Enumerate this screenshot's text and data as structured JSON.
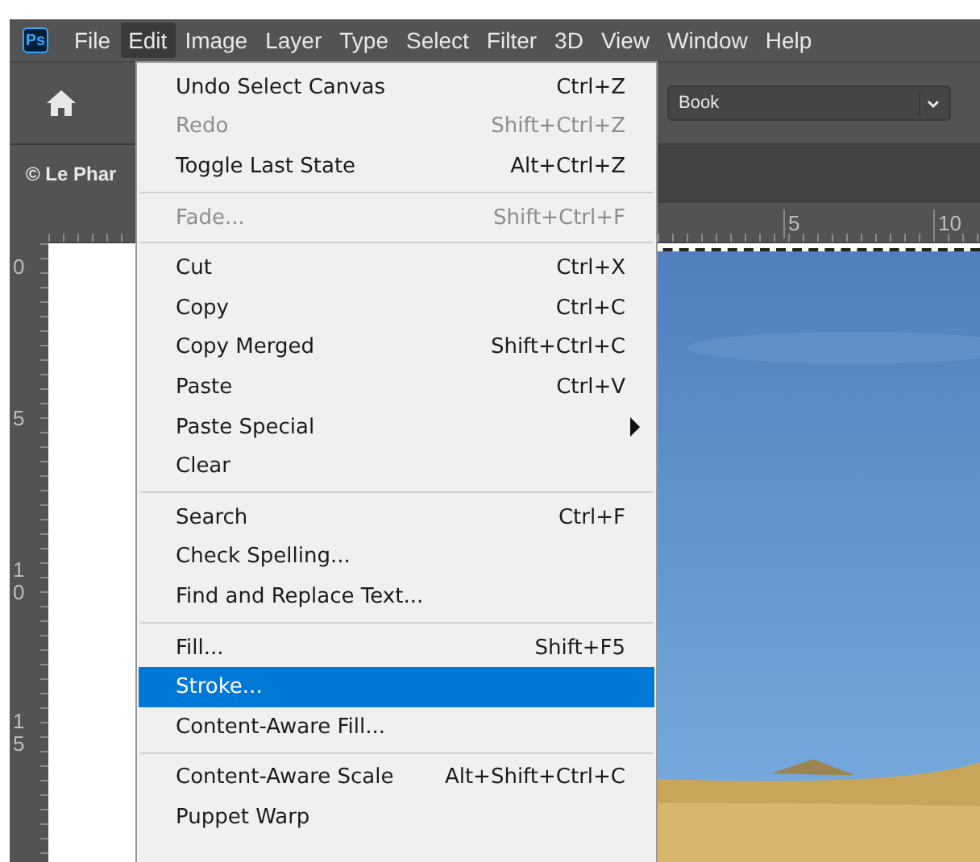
{
  "app": {
    "logo": "Ps"
  },
  "menubar": [
    {
      "label": "File",
      "selected": false
    },
    {
      "label": "Edit",
      "selected": true
    },
    {
      "label": "Image",
      "selected": false
    },
    {
      "label": "Layer",
      "selected": false
    },
    {
      "label": "Type",
      "selected": false
    },
    {
      "label": "Select",
      "selected": false
    },
    {
      "label": "Filter",
      "selected": false
    },
    {
      "label": "3D",
      "selected": false
    },
    {
      "label": "View",
      "selected": false
    },
    {
      "label": "Window",
      "selected": false
    },
    {
      "label": "Help",
      "selected": false
    }
  ],
  "options_bar": {
    "dropdown_value": "Book"
  },
  "document_tab": {
    "title": "© Le Phar"
  },
  "ruler": {
    "horizontal": [
      "5",
      "10"
    ],
    "vertical": [
      "0",
      "5",
      "10",
      "15"
    ]
  },
  "edit_menu": {
    "groups": [
      [
        {
          "label": "Undo Select Canvas",
          "shortcut": "Ctrl+Z",
          "disabled": false,
          "selected": false
        },
        {
          "label": "Redo",
          "shortcut": "Shift+Ctrl+Z",
          "disabled": true,
          "selected": false
        },
        {
          "label": "Toggle Last State",
          "shortcut": "Alt+Ctrl+Z",
          "disabled": false,
          "selected": false
        }
      ],
      [
        {
          "label": "Fade...",
          "shortcut": "Shift+Ctrl+F",
          "disabled": true,
          "selected": false
        }
      ],
      [
        {
          "label": "Cut",
          "shortcut": "Ctrl+X",
          "disabled": false,
          "selected": false
        },
        {
          "label": "Copy",
          "shortcut": "Ctrl+C",
          "disabled": false,
          "selected": false
        },
        {
          "label": "Copy Merged",
          "shortcut": "Shift+Ctrl+C",
          "disabled": false,
          "selected": false
        },
        {
          "label": "Paste",
          "shortcut": "Ctrl+V",
          "disabled": false,
          "selected": false
        },
        {
          "label": "Paste Special",
          "submenu": true,
          "disabled": false,
          "selected": false
        },
        {
          "label": "Clear",
          "disabled": false,
          "selected": false
        }
      ],
      [
        {
          "label": "Search",
          "shortcut": "Ctrl+F",
          "disabled": false,
          "selected": false
        },
        {
          "label": "Check Spelling...",
          "disabled": false,
          "selected": false
        },
        {
          "label": "Find and Replace Text...",
          "disabled": false,
          "selected": false
        }
      ],
      [
        {
          "label": "Fill...",
          "shortcut": "Shift+F5",
          "disabled": false,
          "selected": false
        },
        {
          "label": "Stroke...",
          "disabled": false,
          "selected": true
        },
        {
          "label": "Content-Aware Fill...",
          "disabled": false,
          "selected": false
        }
      ],
      [
        {
          "label": "Content-Aware Scale",
          "shortcut": "Alt+Shift+Ctrl+C",
          "disabled": false,
          "selected": false
        },
        {
          "label": "Puppet Warp",
          "disabled": false,
          "selected": false
        }
      ]
    ]
  }
}
